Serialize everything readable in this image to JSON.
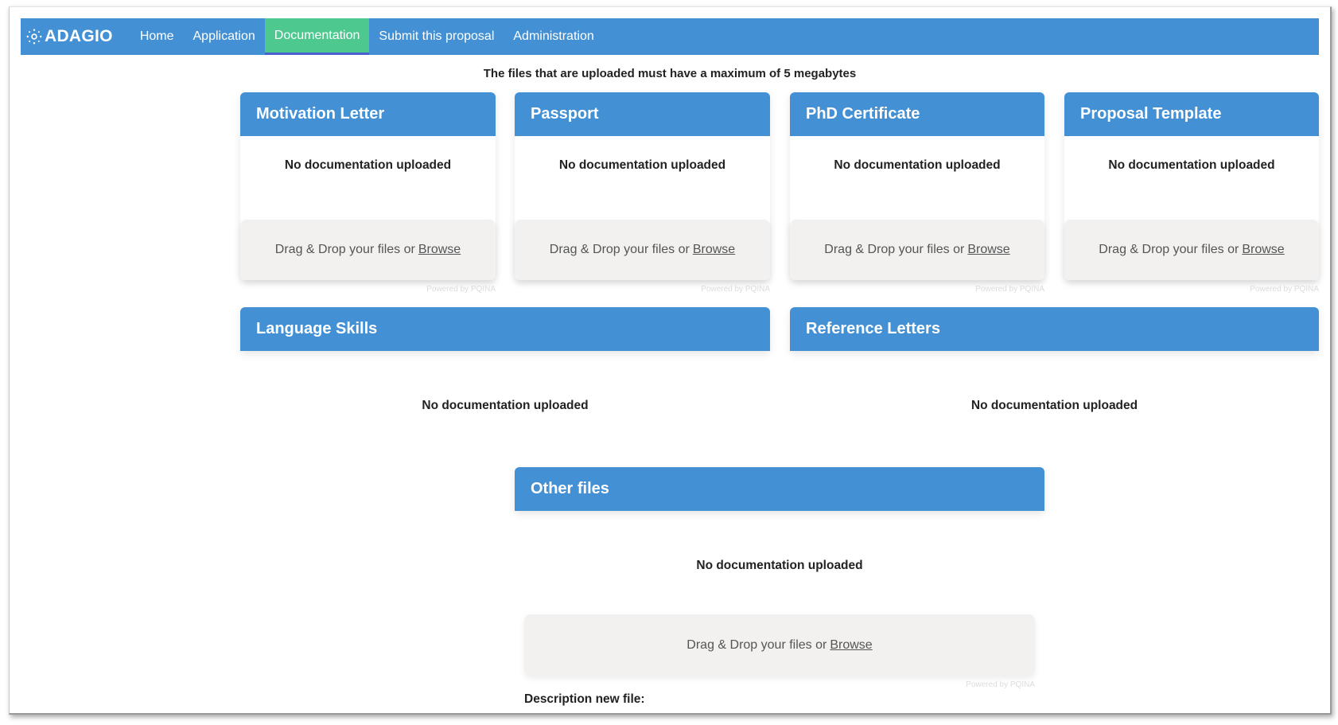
{
  "nav": {
    "brand": "ADAGIO",
    "items": [
      {
        "label": "Home",
        "active": false
      },
      {
        "label": "Application",
        "active": false
      },
      {
        "label": "Documentation",
        "active": true
      },
      {
        "label": "Submit this proposal",
        "active": false
      },
      {
        "label": "Administration",
        "active": false
      }
    ]
  },
  "notice": "The files that are uploaded must have a maximum of 5 megabytes",
  "dropzone": {
    "text": "Drag & Drop your files or",
    "browse": "Browse",
    "powered": "Powered by PQINA"
  },
  "cards": [
    {
      "title": "Motivation Letter",
      "status": "No documentation uploaded"
    },
    {
      "title": "Passport",
      "status": "No documentation uploaded"
    },
    {
      "title": "PhD Certificate",
      "status": "No documentation uploaded"
    },
    {
      "title": "Proposal Template",
      "status": "No documentation uploaded"
    },
    {
      "title": "Language Skills",
      "status": "No documentation uploaded"
    },
    {
      "title": "Reference Letters",
      "status": "No documentation uploaded"
    },
    {
      "title": "Other files",
      "status": "No documentation uploaded"
    }
  ],
  "other_files": {
    "description_label": "Description new file:"
  },
  "colors": {
    "primary": "#4391d4",
    "active_nav": "#4dc98f",
    "dropzone_bg": "#f2f1f0"
  }
}
